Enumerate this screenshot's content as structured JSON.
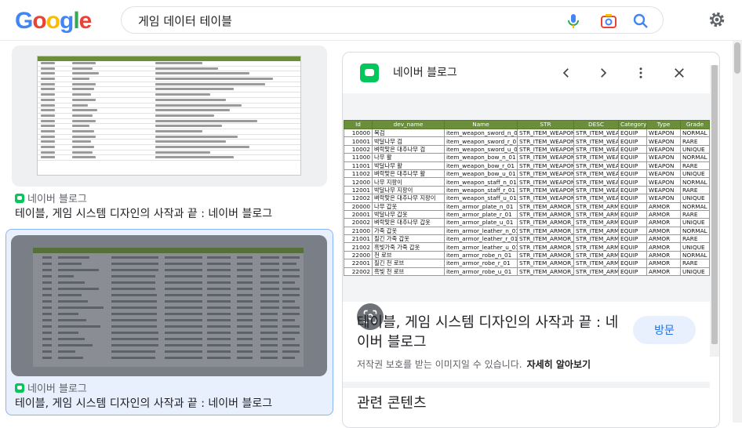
{
  "logo": "Google",
  "search": {
    "query": "게임 데이터 테이블"
  },
  "results": [
    {
      "source": "네이버 블로그",
      "title": "테이블, 게임 시스템 디자인의 사작과 끝 : 네이버 블로그"
    },
    {
      "source": "네이버 블로그",
      "title": "테이블, 게임 시스템 디자인의 사작과 끝 : 네이버 블로그"
    }
  ],
  "panel": {
    "site": "네이버 블로그",
    "title": "테이블, 게임 시스템 디자인의 사작과 끝 : 네이버 블로그",
    "visit_label": "방문",
    "copyright": "저작권 보호를 받는 이미지일 수 있습니다.",
    "learn_more": "자세히 알아보기",
    "related": "관련 콘텐츠"
  },
  "table": {
    "headers": [
      "Id",
      "dev_name",
      "Name",
      "STR",
      "DESC",
      "Category",
      "Type",
      "Grade"
    ],
    "rows": [
      [
        "10000",
        "목검",
        "item_weapon_sword_n_01",
        "STR_ITEM_WEAPON_S",
        "STR_ITEM_WEAF",
        "EQUIP",
        "WEAPON",
        "NORMAL"
      ],
      [
        "10001",
        "박달나무 검",
        "item_weapon_sword_r_01",
        "STR_ITEM_WEAPON_S",
        "STR_ITEM_WEAF",
        "EQUIP",
        "WEAPON",
        "RARE"
      ],
      [
        "10002",
        "벼락맞은 대추나무 검",
        "item_weapon_sword_u_01",
        "STR_ITEM_WEAPON_S",
        "STR_ITEM_WEAF",
        "EQUIP",
        "WEAPON",
        "UNIQUE"
      ],
      [
        "11000",
        "나무 활",
        "item_weapon_bow_n_01",
        "STR_ITEM_WEAPON_B",
        "STR_ITEM_WEAF",
        "EQUIP",
        "WEAPON",
        "NORMAL"
      ],
      [
        "11001",
        "박달나무 활",
        "item_weapon_bow_r_01",
        "STR_ITEM_WEAPON_B",
        "STR_ITEM_WEAF",
        "EQUIP",
        "WEAPON",
        "RARE"
      ],
      [
        "11002",
        "벼락맞은 대추나무 활",
        "item_weapon_bow_u_01",
        "STR_ITEM_WEAPON_B",
        "STR_ITEM_WEAF",
        "EQUIP",
        "WEAPON",
        "UNIQUE"
      ],
      [
        "12000",
        "나무 지팡이",
        "item_weapon_staff_n_01",
        "STR_ITEM_WEAPON_S",
        "STR_ITEM_WEAF",
        "EQUIP",
        "WEAPON",
        "NORMAL"
      ],
      [
        "12001",
        "박달나무 지팡이",
        "item_weapon_staff_r_01",
        "STR_ITEM_WEAPON_S",
        "STR_ITEM_WEAF",
        "EQUIP",
        "WEAPON",
        "RARE"
      ],
      [
        "12002",
        "벼락맞은 대추나무 지팡이",
        "item_weapon_staff_u_01",
        "STR_ITEM_WEAPON_S",
        "STR_ITEM_WEAF",
        "EQUIP",
        "WEAPON",
        "UNIQUE"
      ],
      [
        "20000",
        "나무 갑옷",
        "item_armor_plate_n_01",
        "STR_ITEM_ARMOR_PL",
        "STR_ITEM_ARMC",
        "EQUIP",
        "ARMOR",
        "NORMAL"
      ],
      [
        "20001",
        "박달나무 갑옷",
        "item_armor_plate_r_01",
        "STR_ITEM_ARMOR_PL",
        "STR_ITEM_ARMC",
        "EQUIP",
        "ARMOR",
        "RARE"
      ],
      [
        "20002",
        "벼락맞은 대추나무 갑옷",
        "item_armor_plate_u_01",
        "STR_ITEM_ARMOR_PL",
        "STR_ITEM_ARMC",
        "EQUIP",
        "ARMOR",
        "UNIQUE"
      ],
      [
        "21000",
        "가죽 갑옷",
        "item_armor_leather_n_01",
        "STR_ITEM_ARMOR_LE",
        "STR_ITEM_ARMC",
        "EQUIP",
        "ARMOR",
        "NORMAL"
      ],
      [
        "21001",
        "질긴 가죽 갑옷",
        "item_armor_leather_r_01",
        "STR_ITEM_ARMOR_LE",
        "STR_ITEM_ARMC",
        "EQUIP",
        "ARMOR",
        "RARE"
      ],
      [
        "21002",
        "흑빛가죽 가죽 갑옷",
        "item_armor_leather_u_01",
        "STR_ITEM_ARMOR_LE",
        "STR_ITEM_ARMC",
        "EQUIP",
        "ARMOR",
        "UNIQUE"
      ],
      [
        "22000",
        "천 로브",
        "item_armor_robe_n_01",
        "STR_ITEM_ARMOR_RC",
        "STR_ITEM_ARMC",
        "EQUIP",
        "ARMOR",
        "NORMAL"
      ],
      [
        "22001",
        "질긴 천 로브",
        "item_armor_robe_r_01",
        "STR_ITEM_ARMOR_RC",
        "STR_ITEM_ARMC",
        "EQUIP",
        "ARMOR",
        "RARE"
      ],
      [
        "22002",
        "흑빛 천 로브",
        "item_armor_robe_u_01",
        "STR_ITEM_ARMOR_RC",
        "STR_ITEM_ARMC",
        "EQUIP",
        "ARMOR",
        "UNIQUE"
      ]
    ]
  },
  "icons": {
    "mic": "mic-icon",
    "camera": "camera-search-icon",
    "search": "search-icon",
    "settings": "gear-icon",
    "back": "chevron-left-icon",
    "forward": "chevron-right-icon",
    "more": "more-vert-icon",
    "close": "close-icon",
    "lens": "lens-icon"
  },
  "colors": {
    "table_header": "#6b8e3a",
    "naver": "#03c75a",
    "link": "#1a73e8"
  }
}
